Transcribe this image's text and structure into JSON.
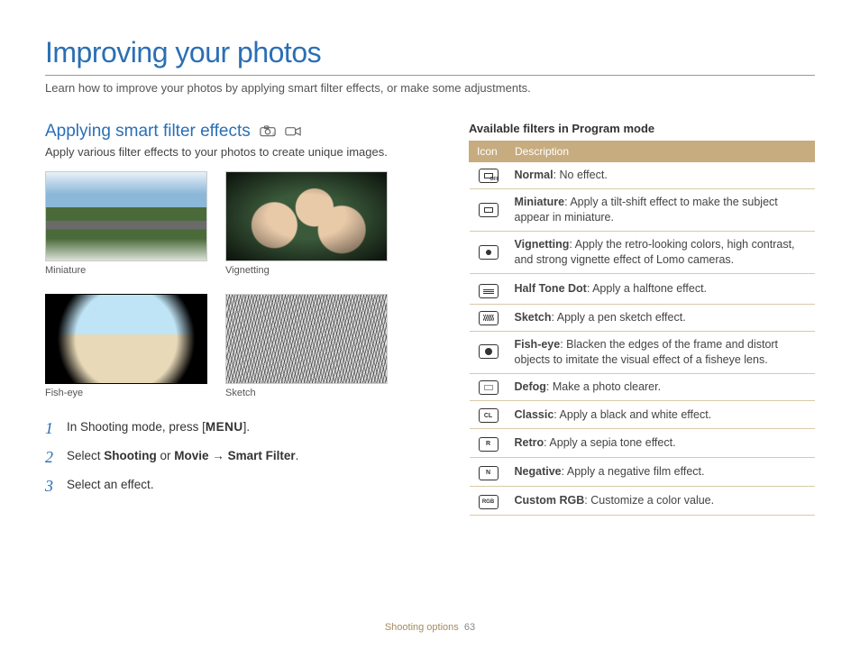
{
  "page_title": "Improving your photos",
  "page_subtitle": "Learn how to improve your photos by applying smart filter effects, or make some adjustments.",
  "section": {
    "heading": "Applying smart filter effects",
    "desc": "Apply various filter effects to your photos to create unique images."
  },
  "samples": [
    {
      "caption": "Miniature"
    },
    {
      "caption": "Vignetting"
    },
    {
      "caption": "Fish-eye"
    },
    {
      "caption": "Sketch"
    }
  ],
  "steps": {
    "s1_a": "In Shooting mode, press [",
    "s1_menu": "MENU",
    "s1_b": "].",
    "s2_a": "Select ",
    "s2_b": "Shooting",
    "s2_c": " or ",
    "s2_d": "Movie",
    "s2_e": " → ",
    "s2_f": "Smart Filter",
    "s2_g": ".",
    "s3": "Select an effect."
  },
  "nums": {
    "n1": "1",
    "n2": "2",
    "n3": "3"
  },
  "right_heading": "Available filters in Program mode",
  "table": {
    "h_icon": "Icon",
    "h_desc": "Description",
    "rows": [
      {
        "name": "Normal",
        "desc": ": No effect."
      },
      {
        "name": "Miniature",
        "desc": ": Apply a tilt-shift effect to make the subject appear in miniature."
      },
      {
        "name": "Vignetting",
        "desc": ": Apply the retro-looking colors, high contrast, and strong vignette effect of Lomo cameras."
      },
      {
        "name": "Half Tone Dot",
        "desc": ": Apply a halftone effect."
      },
      {
        "name": "Sketch",
        "desc": ": Apply a pen sketch effect."
      },
      {
        "name": "Fish-eye",
        "desc": ": Blacken the edges of the frame and distort objects to imitate the visual effect of a fisheye lens."
      },
      {
        "name": "Defog",
        "desc": ": Make a photo clearer."
      },
      {
        "name": "Classic",
        "desc": ": Apply a black and white effect."
      },
      {
        "name": "Retro",
        "desc": ": Apply a sepia tone effect."
      },
      {
        "name": "Negative",
        "desc": ": Apply a negative film effect."
      },
      {
        "name": "Custom RGB",
        "desc": ": Customize a color value."
      }
    ]
  },
  "footer": {
    "section": "Shooting options",
    "page": "63"
  }
}
